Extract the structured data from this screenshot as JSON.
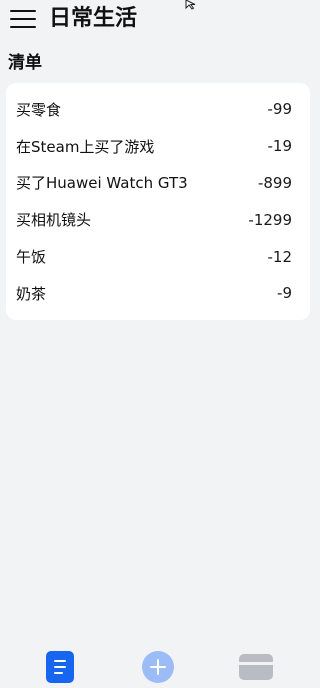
{
  "header": {
    "title": "日常生活",
    "menu_icon": "hamburger-menu-icon"
  },
  "list": {
    "title": "清单",
    "items": [
      {
        "name": "买零食",
        "amount": "-99"
      },
      {
        "name": "在Steam上买了游戏",
        "amount": "-19"
      },
      {
        "name": "买了Huawei Watch GT3",
        "amount": "-899"
      },
      {
        "name": "买相机镜头",
        "amount": "-1299"
      },
      {
        "name": "午饭",
        "amount": "-12"
      },
      {
        "name": "奶茶",
        "amount": "-9"
      }
    ]
  },
  "bottom_nav": {
    "tabs": [
      {
        "icon": "list-document-icon",
        "active": true,
        "color": "#1766f0"
      },
      {
        "icon": "add-circle-icon",
        "active": false,
        "color": "#9cbcf7"
      },
      {
        "icon": "wallet-card-icon",
        "active": false,
        "color": "#b9bcc2"
      }
    ]
  }
}
